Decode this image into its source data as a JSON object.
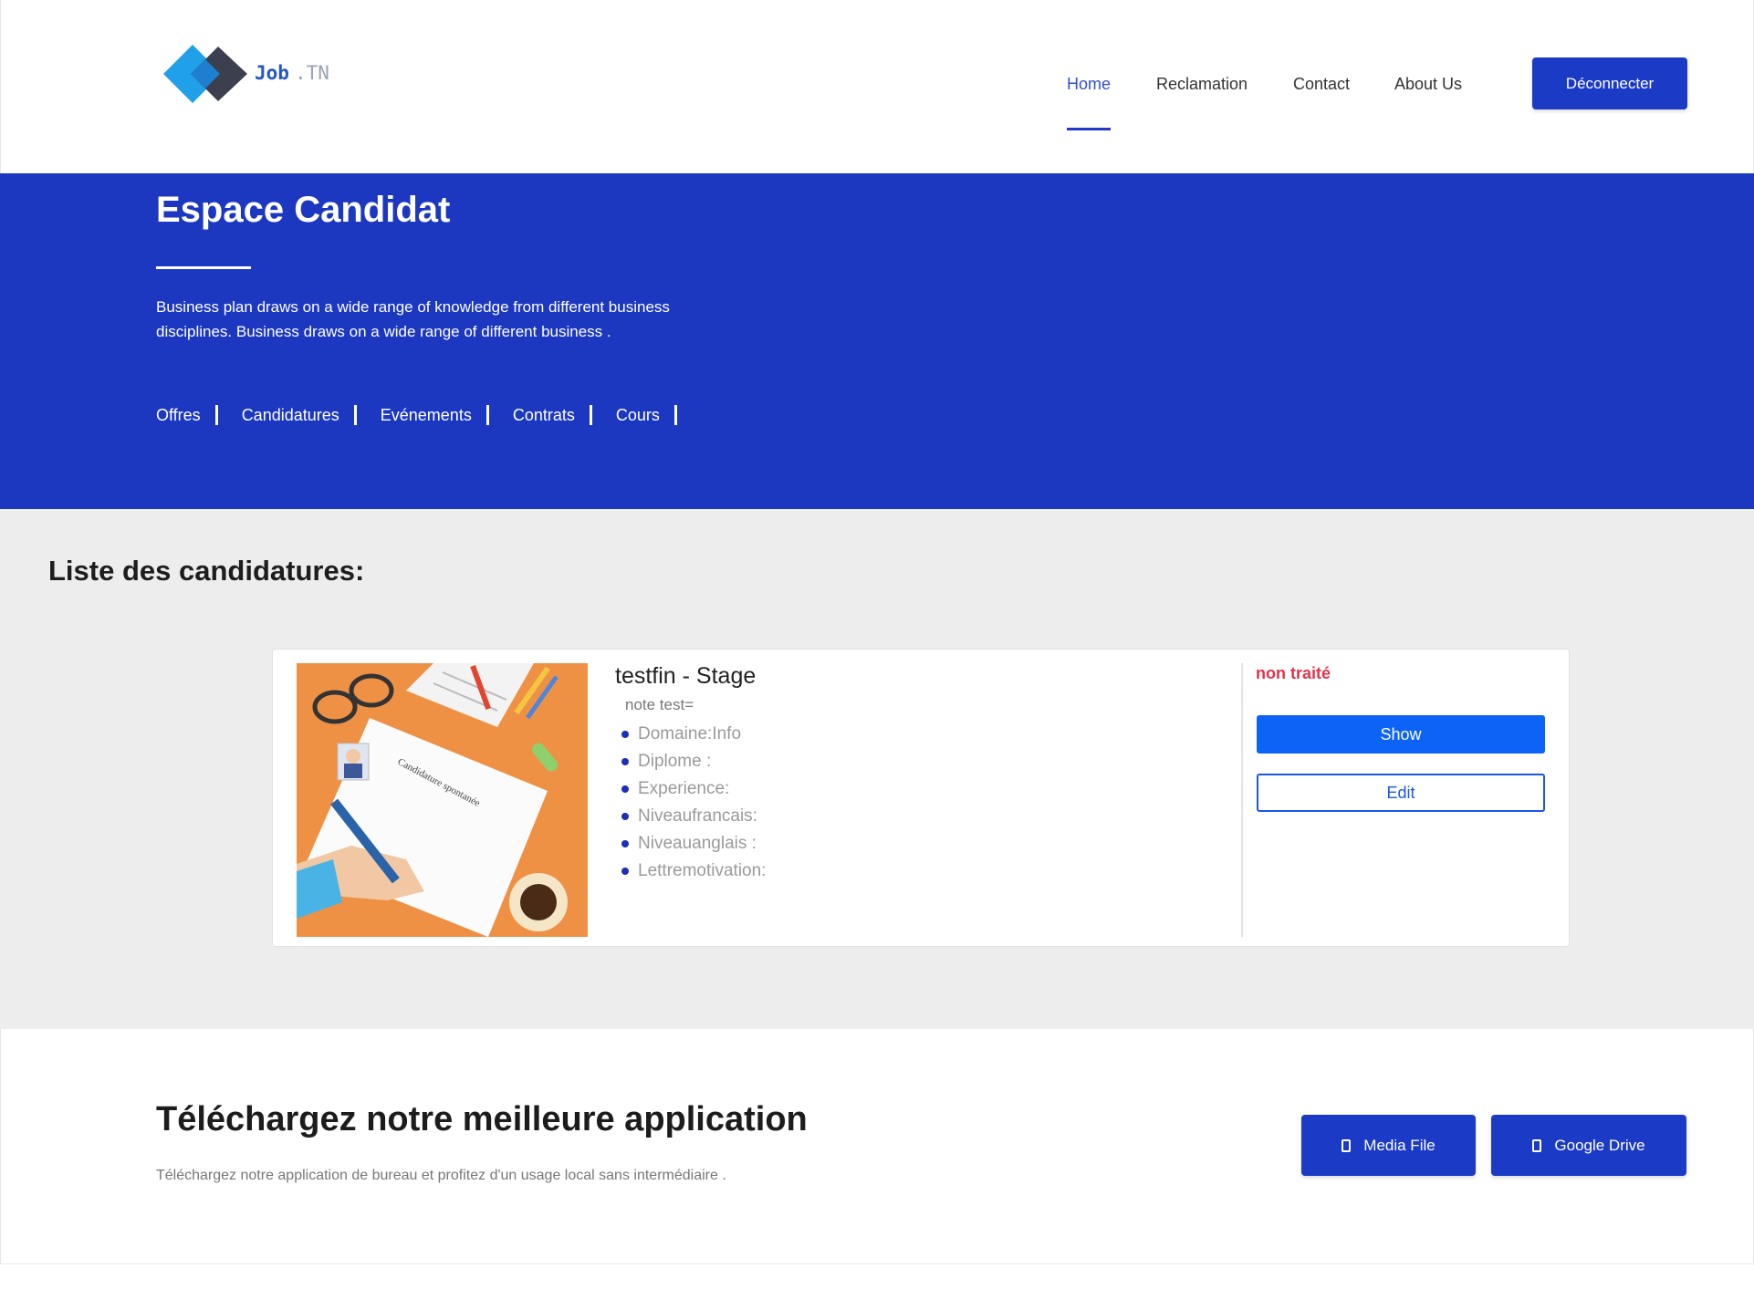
{
  "header": {
    "logo": {
      "text_main": "Job",
      "text_suffix": ".TN"
    },
    "nav": [
      {
        "label": "Home",
        "active": true
      },
      {
        "label": "Reclamation",
        "active": false
      },
      {
        "label": "Contact",
        "active": false
      },
      {
        "label": "About Us",
        "active": false
      }
    ],
    "logout_label": "Déconnecter"
  },
  "hero": {
    "title": "Espace Candidat",
    "description": "Business plan draws on a wide range of knowledge from different business disciplines. Business draws on a wide range of different business .",
    "links": [
      "Offres",
      "Candidatures",
      "Evénements",
      "Contrats",
      "Cours"
    ]
  },
  "list": {
    "title": "Liste des candidatures:",
    "cards": [
      {
        "image_icon": "candidature-spontanee-illustration",
        "image_caption": "Candidature spontanée",
        "title": "testfin - Stage",
        "note": "note test=",
        "fields": [
          "Domaine:Info",
          "Diplome :",
          "Experience:",
          "Niveaufrancais:",
          "Niveauanglais :",
          "Lettremotivation:"
        ],
        "status": "non traité",
        "show_label": "Show",
        "edit_label": "Edit"
      }
    ]
  },
  "download": {
    "title": "Téléchargez notre meilleure application",
    "description": "Téléchargez notre application de bureau et profitez d'un usage local sans intermédiaire .",
    "buttons": [
      {
        "label": "Media File",
        "icon": "file-icon"
      },
      {
        "label": "Google Drive",
        "icon": "file-icon"
      }
    ]
  },
  "colors": {
    "brand_blue": "#1c38c0",
    "button_blue": "#1b3ac6",
    "show_blue": "#0c63f5",
    "status_red": "#e0344c",
    "section_gray": "#ededed"
  }
}
